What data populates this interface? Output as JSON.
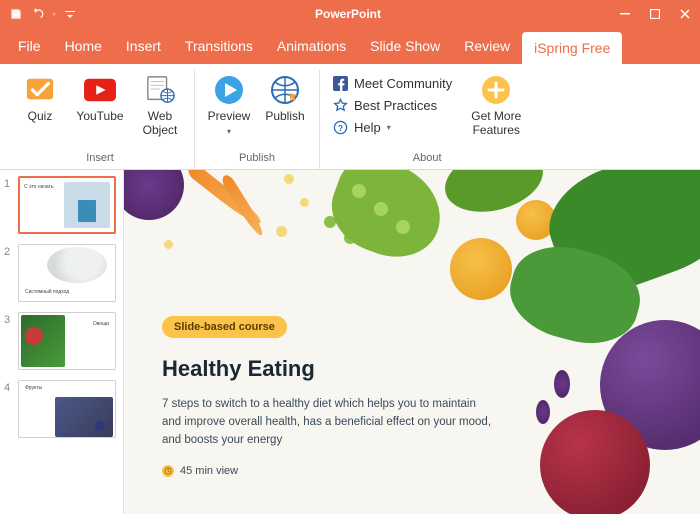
{
  "app": {
    "title": "PowerPoint"
  },
  "menu": [
    "File",
    "Home",
    "Insert",
    "Transitions",
    "Animations",
    "Slide Show",
    "Review",
    "iSpring Free"
  ],
  "activeTab": 7,
  "ribbon": {
    "groups": [
      {
        "label": "Insert",
        "buttons": [
          {
            "name": "quiz-button",
            "label": "Quiz"
          },
          {
            "name": "youtube-button",
            "label": "YouTube"
          },
          {
            "name": "web-object-button",
            "label": "Web Object"
          }
        ]
      },
      {
        "label": "Publish",
        "buttons": [
          {
            "name": "preview-button",
            "label": "Preview",
            "dropdown": true
          },
          {
            "name": "publish-button",
            "label": "Publish"
          }
        ]
      },
      {
        "label": "About",
        "links": [
          {
            "name": "meet-community-link",
            "label": "Meet Community"
          },
          {
            "name": "best-practices-link",
            "label": "Best Practices"
          },
          {
            "name": "help-link",
            "label": "Help",
            "dropdown": true
          }
        ],
        "buttons": [
          {
            "name": "get-more-features-button",
            "label": "Get More Features"
          }
        ]
      }
    ]
  },
  "thumbs": [
    {
      "num": "1"
    },
    {
      "num": "2"
    },
    {
      "num": "3"
    },
    {
      "num": "4"
    }
  ],
  "slide": {
    "badge": "Slide-based course",
    "title": "Healthy Eating",
    "desc": "7 steps to switch to a healthy diet which helps you to maintain and improve overall health, has a beneficial effect on your mood, and boosts your energy",
    "meta": "45 min view"
  }
}
